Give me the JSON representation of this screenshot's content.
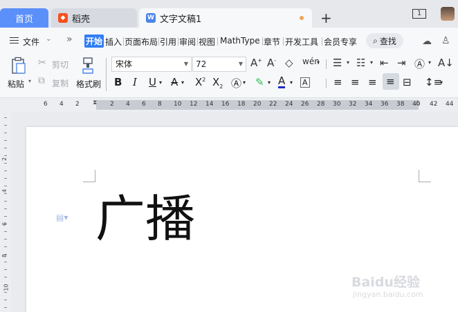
{
  "tabs": {
    "home": "首页",
    "daoke": "稻壳",
    "doc": "文字文稿1",
    "window_count": "1"
  },
  "menu": {
    "file": "文件",
    "items": [
      "开始",
      "插入",
      "页面布局",
      "引用",
      "审阅",
      "视图",
      "MathType",
      "章节",
      "开发工具",
      "会员专享"
    ],
    "search": "查找"
  },
  "toolbar": {
    "paste": "粘贴",
    "cut": "剪切",
    "copy": "复制",
    "format_painter": "格式刷",
    "font_name": "宋体",
    "font_size": "72"
  },
  "ruler": {
    "numbers": [
      "6",
      "4",
      "2",
      "2",
      "4",
      "6",
      "8",
      "10",
      "12",
      "14",
      "16",
      "18",
      "20",
      "22",
      "24",
      "26",
      "28",
      "30",
      "32",
      "34",
      "36",
      "38",
      "40",
      "42",
      "44"
    ]
  },
  "vruler": {
    "numbers": [
      "2",
      "4",
      "6",
      "8",
      "10"
    ]
  },
  "document": {
    "text": "广播"
  },
  "watermark": {
    "brand": "Baidu经验",
    "url": "jingyan.baidu.com"
  },
  "colors": {
    "accent": "#2f7ef5",
    "home_tab": "#5b8ff9",
    "highlight": "#2ec04f",
    "font_color": "#1a2cc8"
  }
}
